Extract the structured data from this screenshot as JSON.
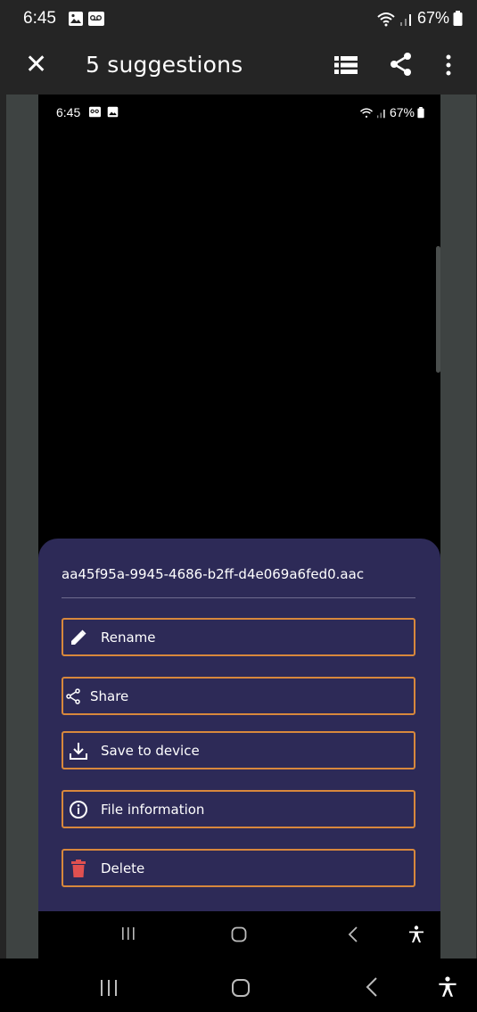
{
  "status": {
    "time": "6:45",
    "battery": "67%"
  },
  "appbar": {
    "title": "5 suggestions"
  },
  "inner_status": {
    "time": "6:45",
    "battery": "67%"
  },
  "sheet": {
    "filename": "aa45f95a-9945-4686-b2ff-d4e069a6fed0.aac",
    "options": [
      {
        "label": "Rename",
        "icon": "pencil-icon"
      },
      {
        "label": "Share",
        "icon": "share-icon"
      },
      {
        "label": "Save to device",
        "icon": "download-icon"
      },
      {
        "label": "File information",
        "icon": "info-icon"
      },
      {
        "label": "Delete",
        "icon": "trash-icon"
      }
    ]
  },
  "colors": {
    "sheet_bg": "#2d2a57",
    "option_border": "#d8883c",
    "delete_icon": "#e05050"
  }
}
